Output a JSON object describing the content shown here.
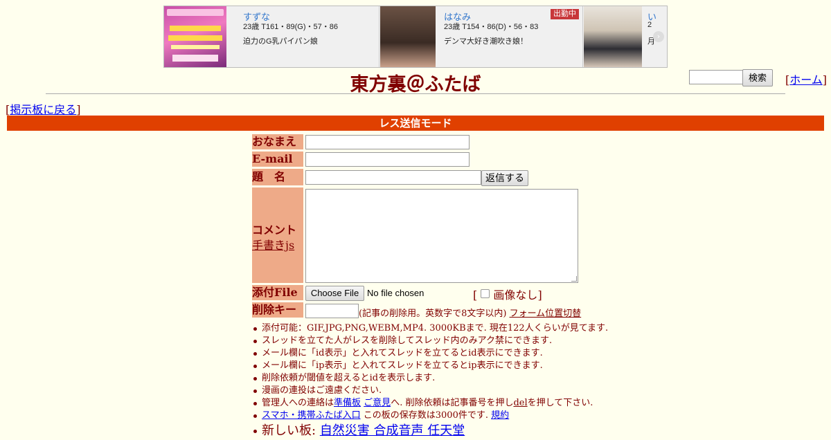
{
  "banner": {
    "promo_image": "valentine-event-banner",
    "cards": [
      {
        "name": "すずな",
        "stats": "23歳 T161・89(G)・57・86",
        "desc": "迫力のG乳パイパン娘"
      },
      {
        "name": "はなみ",
        "stats": "23歳 T154・86(D)・56・83",
        "desc": "デンマ大好き潮吹き娘！",
        "badge": "出勤中"
      },
      {
        "name": "い",
        "stats": "2",
        "desc": "月"
      }
    ],
    "prev_icon": "chevron-left-icon",
    "next_icon": "chevron-right-icon"
  },
  "header": {
    "title": "東方裏＠ふたば",
    "search_button": "検索",
    "home_link": "ホーム",
    "back_link": "掲示板に戻る"
  },
  "mode_bar": "レス送信モード",
  "form": {
    "name_label": "おなまえ",
    "email_label": "E-mail",
    "subject_label": "題　名",
    "submit_button": "返信する",
    "comment_label": "コメント",
    "handwriting_link": "手書きjs",
    "file_label": "添付File",
    "file_button": "Choose File",
    "file_status": "No file chosen",
    "no_image_label": "画像なし",
    "delete_key_label": "削除キー",
    "delete_key_note": "(記事の削除用。英数字で8文字以内)",
    "form_position_link": "フォーム位置切替"
  },
  "notes": {
    "n1": "添付可能：GIF,JPG,PNG,WEBM,MP4. 3000KBまで. 現在122人くらいが見てます.",
    "n2": "スレッドを立てた人がレスを削除してスレッド内のみアク禁にできます.",
    "n3": "メール欄に「id表示」と入れてスレッドを立てるとid表示にできます.",
    "n4": "メール欄に「ip表示」と入れてスレッドを立てるとip表示にできます.",
    "n5": "削除依頼が閾値を超えるとidを表示します.",
    "n6": "漫画の連投はご遠慮ください.",
    "n7_prefix": "管理人への連絡は",
    "n7_link1": "準備板",
    "n7_link2": "ご意見",
    "n7_mid": "へ. 削除依頼は記事番号を押し",
    "n7_del": "del",
    "n7_suffix": "を押して下さい.",
    "n8_link": "スマホ・携帯ふたば入口",
    "n8_mid": "この板の保存数は3000件です.",
    "n8_rules": "規約",
    "n9_prefix": "新しい板:",
    "n9_links": "自然災害 合成音声 任天堂"
  }
}
